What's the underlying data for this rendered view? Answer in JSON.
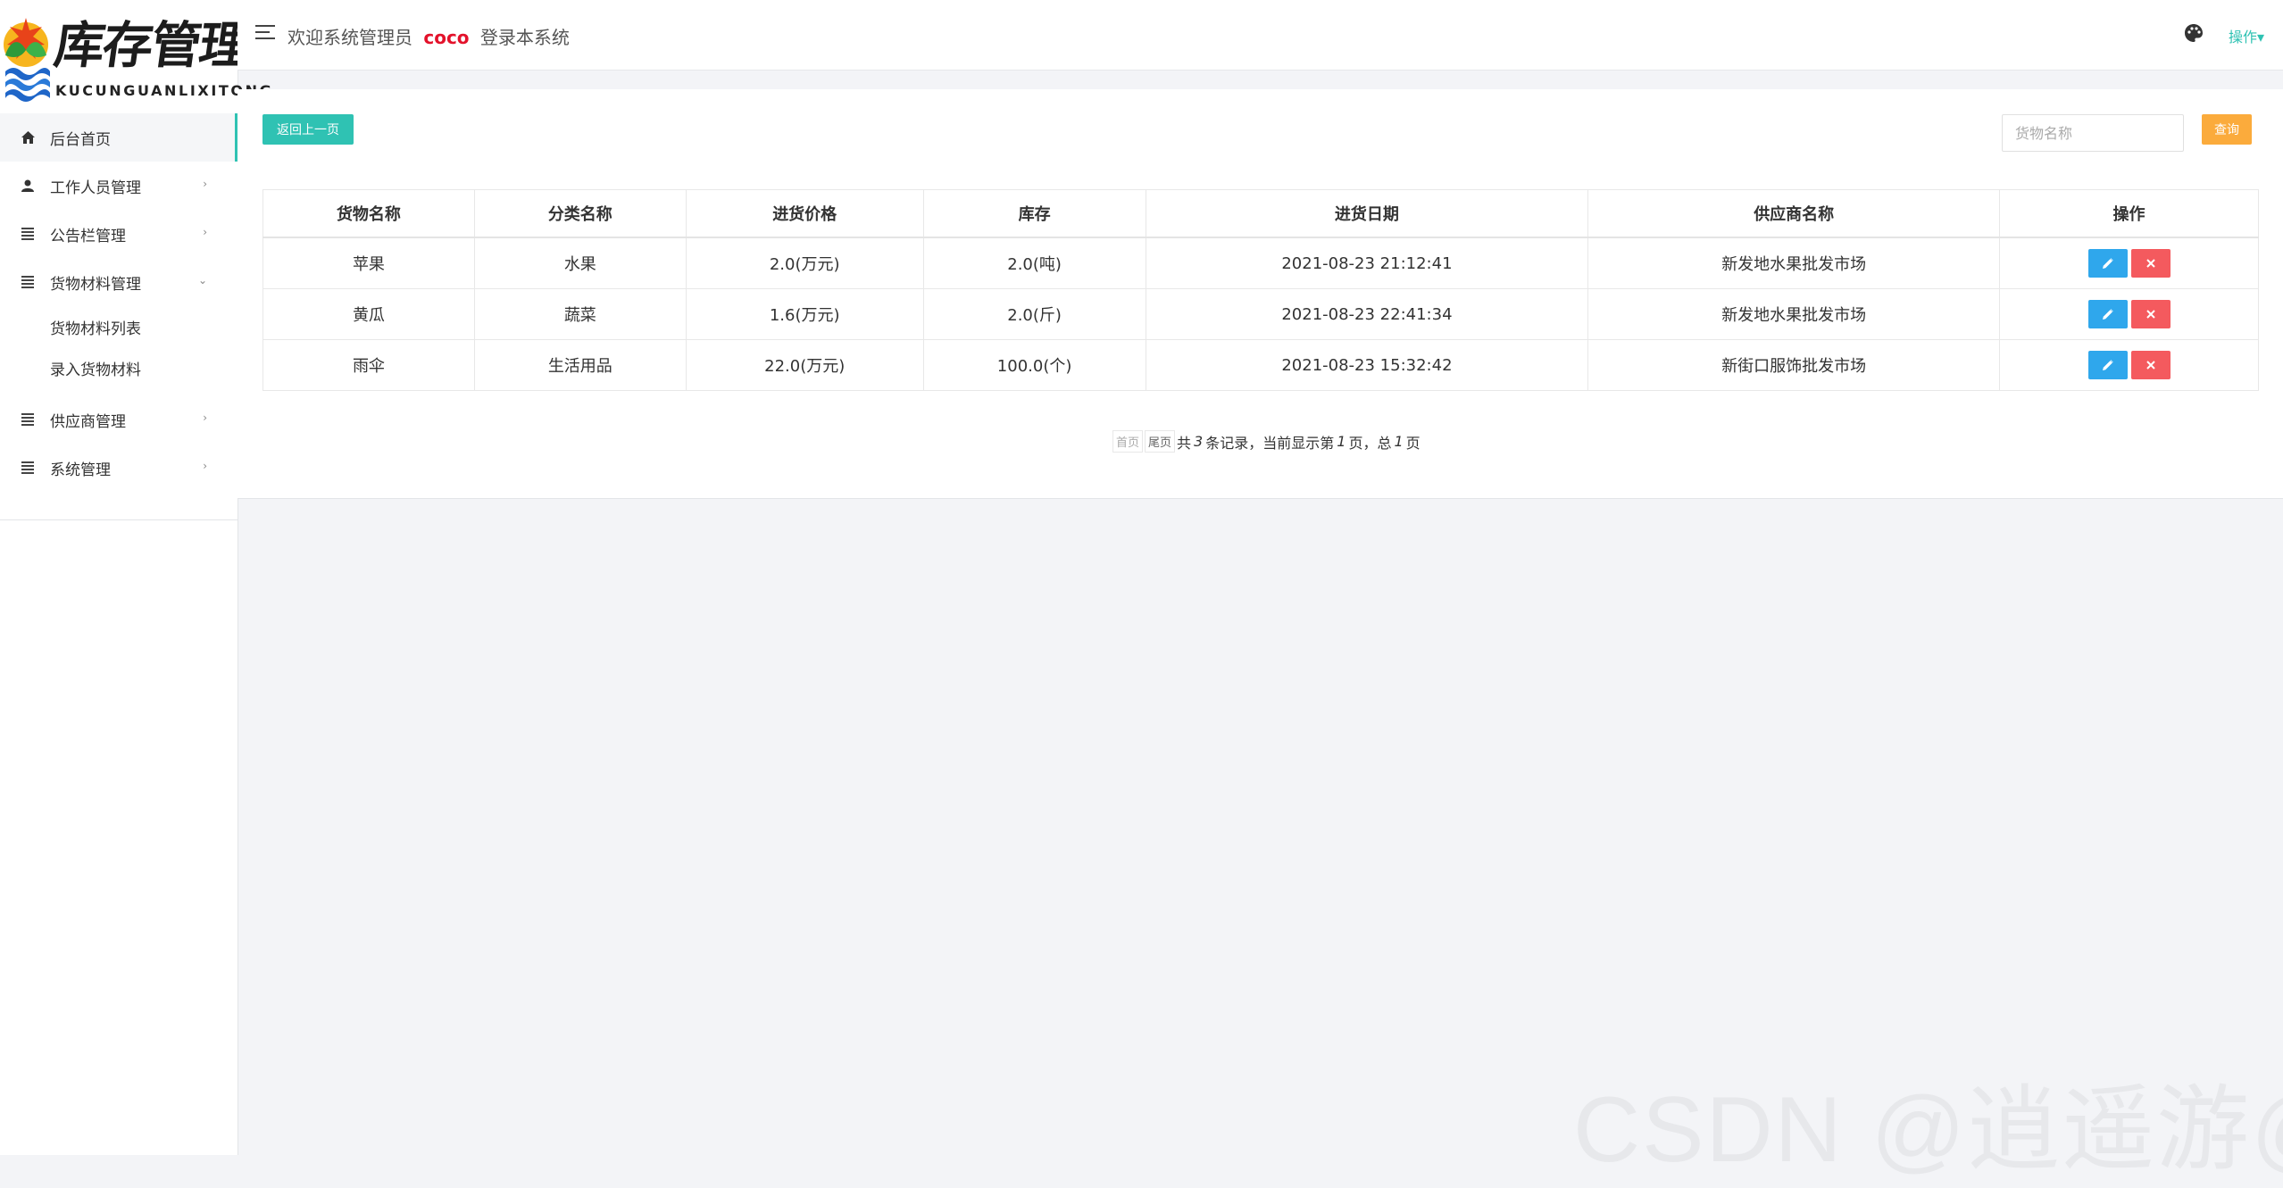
{
  "logo": {
    "title": "库存管理系统",
    "subtitle": "KUCUNGUANLIXITONG"
  },
  "sidebar": {
    "items": [
      {
        "label": "后台首页"
      },
      {
        "label": "工作人员管理"
      },
      {
        "label": "公告栏管理"
      },
      {
        "label": "货物材料管理"
      },
      {
        "label": "供应商管理"
      },
      {
        "label": "系统管理"
      }
    ],
    "submenu": [
      {
        "label": "货物材料列表"
      },
      {
        "label": "录入货物材料"
      }
    ],
    "accent": "#2fc2b3"
  },
  "header": {
    "welcome_prefix": "欢迎系统管理员",
    "username": "coco",
    "welcome_suffix": "登录本系统",
    "ops_label": "操作▾"
  },
  "toolbar": {
    "back_label": "返回上一页",
    "search_placeholder": "货物名称",
    "query_label": "查询"
  },
  "table": {
    "columns": [
      "货物名称",
      "分类名称",
      "进货价格",
      "库存",
      "进货日期",
      "供应商名称",
      "操作"
    ],
    "rows": [
      [
        "苹果",
        "水果",
        "2.0(万元)",
        "2.0(吨)",
        "2021-08-23 21:12:41",
        "新发地水果批发市场"
      ],
      [
        "黄瓜",
        "蔬菜",
        "1.6(万元)",
        "2.0(斤)",
        "2021-08-23 22:41:34",
        "新发地水果批发市场"
      ],
      [
        "雨伞",
        "生活用品",
        "22.0(万元)",
        "100.0(个)",
        "2021-08-23 15:32:42",
        "新街口服饰批发市场"
      ]
    ],
    "edit_icon": "pencil-icon",
    "delete_icon": "close-icon"
  },
  "pager": {
    "first": "首页",
    "last": "尾页",
    "t1": "共",
    "total": "3",
    "t2": "条记录，当前显示第",
    "current": "1",
    "t3": "页，总",
    "pages": "1",
    "t4": "页"
  },
  "watermark": "CSDN @逍遥游@"
}
